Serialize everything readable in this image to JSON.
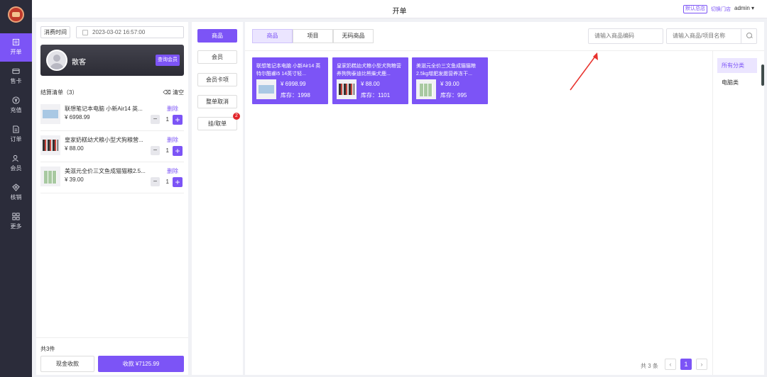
{
  "header": {
    "title": "开单",
    "store_badge": "默认总店",
    "switch_store": "切换门店",
    "user": "admin"
  },
  "nav": [
    {
      "label": "开单",
      "icon": "cashier-icon",
      "active": true
    },
    {
      "label": "售卡",
      "icon": "card-icon"
    },
    {
      "label": "充值",
      "icon": "yen-icon"
    },
    {
      "label": "订单",
      "icon": "order-icon"
    },
    {
      "label": "会员",
      "icon": "member-icon"
    },
    {
      "label": "核销",
      "icon": "verify-icon"
    },
    {
      "label": "更多",
      "icon": "grid-icon"
    }
  ],
  "cart": {
    "time_label": "消费时间",
    "time_value": "2023-03-02 16:57:00",
    "member_name": "散客",
    "query_member": "查询会员",
    "list_title": "结算清单（3）",
    "clear": "清空",
    "delete_label": "删除",
    "items": [
      {
        "name": "联想笔记本电脑 小新Air14 英...",
        "price": "¥ 6998.99",
        "qty": "1"
      },
      {
        "name": "皇家奶糕幼犬粮小型犬狗粮营...",
        "price": "¥ 88.00",
        "qty": "1"
      },
      {
        "name": "美滋元全价三文鱼成猫猫粮2.5...",
        "price": "¥ 39.00",
        "qty": "1"
      }
    ],
    "total_count": "共3件",
    "cash_btn": "现金收款",
    "pay_btn": "收款 ¥7125.99"
  },
  "mid": {
    "buttons": [
      "商品",
      "会员",
      "会员卡项",
      "整单取消",
      "挂/取单"
    ],
    "badge": "2"
  },
  "main": {
    "tabs": [
      "商品",
      "项目",
      "无码商品"
    ],
    "search_code_placeholder": "请输入商品编码",
    "search_name_placeholder": "请输入商品/项目名称",
    "products": [
      {
        "name": "联想笔记本电脑 小新Air14 英特尔酷睿i5 14英寸轻...",
        "price": "¥ 6998.99",
        "stock": "库存：1998"
      },
      {
        "name": "皇家奶糕幼犬粮小型犬狗粮营养狗狗泰迪比熊柴犬鹿...",
        "price": "¥ 88.00",
        "stock": "库存：1101"
      },
      {
        "name": "美滋元全价三文鱼成猫猫粮2.5kg增肥发腮营养冻干...",
        "price": "¥ 39.00",
        "stock": "库存：995"
      }
    ],
    "categories": [
      "所有分类",
      "电脑类"
    ],
    "pager_total": "共 3 条",
    "current_page": "1"
  },
  "colors": {
    "accent": "#7c54f6",
    "nav_bg": "#2b2c3a",
    "annotation_arrow": "#e8322d"
  }
}
